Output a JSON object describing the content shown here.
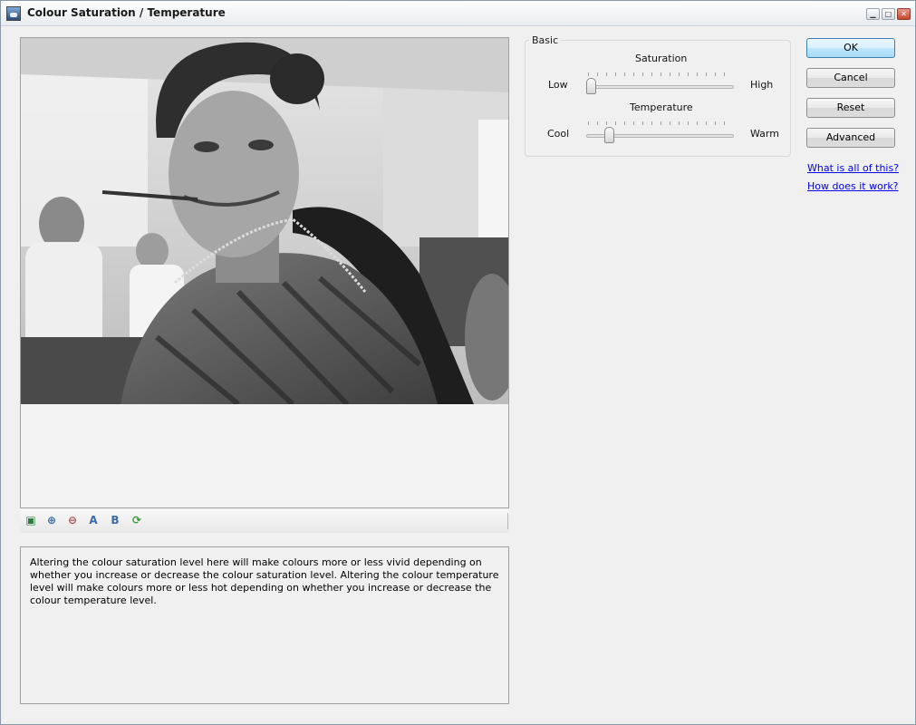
{
  "window": {
    "title": "Colour Saturation / Temperature",
    "controls": [
      "minimize",
      "maximize",
      "close"
    ]
  },
  "preview": {
    "image_description_icon": "grayscale-photo",
    "toolbar": [
      {
        "name": "fit-icon",
        "glyph": "▣"
      },
      {
        "name": "zoom-in-icon",
        "glyph": "⊕"
      },
      {
        "name": "zoom-out-icon",
        "glyph": "⊖"
      },
      {
        "name": "compare-a-icon",
        "glyph": "A"
      },
      {
        "name": "compare-b-icon",
        "glyph": "B"
      },
      {
        "name": "refresh-icon",
        "glyph": "⟳"
      }
    ]
  },
  "description": "Altering the colour saturation level here will make colours more or less vivid depending on whether you increase or decrease the colour saturation level. Altering the colour temperature level will make colours more or less hot depending on whether you increase or decrease the colour temperature level.",
  "basic": {
    "group_label": "Basic",
    "saturation": {
      "label": "Saturation",
      "low": "Low",
      "high": "High",
      "value_fraction": 0.02
    },
    "temperature": {
      "label": "Temperature",
      "low": "Cool",
      "high": "Warm",
      "value_fraction": 0.15
    }
  },
  "buttons": {
    "ok": "OK",
    "cancel": "Cancel",
    "reset": "Reset",
    "advanced": "Advanced"
  },
  "links": {
    "what": "What is all of this?",
    "how": "How does it work?"
  },
  "colors": {
    "accent": "#3c7fb1",
    "link": "#0000ee",
    "window_bg": "#f0f0f0"
  }
}
